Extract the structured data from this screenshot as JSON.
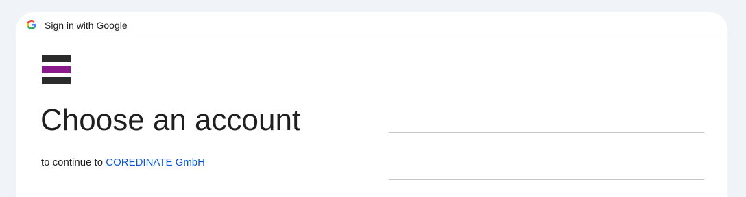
{
  "header": {
    "title": "Sign in with Google",
    "logo_icon": "google-g-icon"
  },
  "brand": {
    "logo_icon": "coredinate-logo",
    "colors": {
      "bar_dark": "#2b2b2b",
      "bar_accent": "#8a1a8c"
    }
  },
  "main": {
    "title": "Choose an account",
    "subtitle_prefix": "to continue to",
    "app_name": "COREDINATE GmbH"
  },
  "colors": {
    "page_background": "#f0f3f8",
    "card_background": "#ffffff",
    "link": "#0b57d0",
    "divider": "#c4c7c5",
    "text": "#1f1f1f"
  }
}
